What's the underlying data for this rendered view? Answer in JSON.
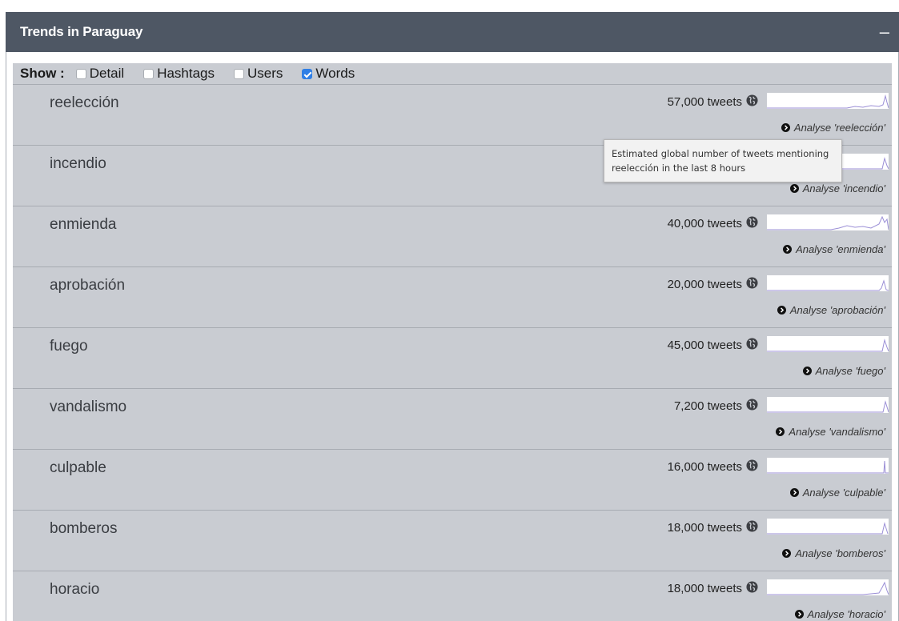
{
  "panel": {
    "title": "Trends in Paraguay",
    "collapse_label": "–"
  },
  "show": {
    "label": "Show :",
    "options": [
      {
        "label": "Detail",
        "checked": false
      },
      {
        "label": "Hashtags",
        "checked": false
      },
      {
        "label": "Users",
        "checked": false
      },
      {
        "label": "Words",
        "checked": true
      }
    ]
  },
  "tooltip": "Estimated global number of tweets mentioning reelección in the last 8 hours",
  "trends": [
    {
      "word": "reelección",
      "tweets": "57,000 tweets",
      "analyse": "Analyse 'reelección'"
    },
    {
      "word": "incendio",
      "tweets": "",
      "analyse": "Analyse 'incendio'"
    },
    {
      "word": "enmienda",
      "tweets": "40,000 tweets",
      "analyse": "Analyse 'enmienda'"
    },
    {
      "word": "aprobación",
      "tweets": "20,000 tweets",
      "analyse": "Analyse 'aprobación'"
    },
    {
      "word": "fuego",
      "tweets": "45,000 tweets",
      "analyse": "Analyse 'fuego'"
    },
    {
      "word": "vandalismo",
      "tweets": "7,200 tweets",
      "analyse": "Analyse 'vandalismo'"
    },
    {
      "word": "culpable",
      "tweets": "16,000 tweets",
      "analyse": "Analyse 'culpable'"
    },
    {
      "word": "bomberos",
      "tweets": "18,000 tweets",
      "analyse": "Analyse 'bomberos'"
    },
    {
      "word": "horacio",
      "tweets": "18,000 tweets",
      "analyse": "Analyse 'horacio'"
    }
  ],
  "colors": {
    "header": "#4e5764",
    "row_bg": "#c9ccd2",
    "spark_line": "#9b8fd6",
    "checkbox": "#2f7fe6"
  }
}
